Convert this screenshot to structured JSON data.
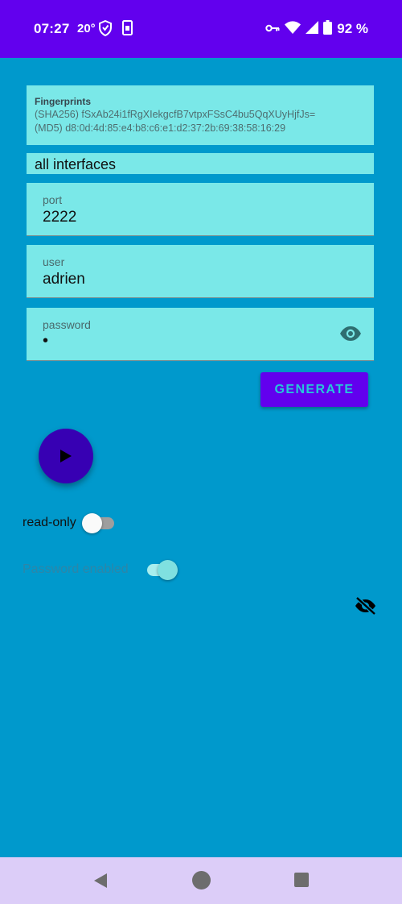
{
  "status_bar": {
    "time": "07:27",
    "temperature": "20°",
    "battery": "92 %",
    "icons": [
      "shield-icon",
      "sim-icon",
      "vpn-key-icon",
      "wifi-icon",
      "signal-icon",
      "battery-icon"
    ]
  },
  "fingerprints": {
    "title": "Fingerprints",
    "sha256": "(SHA256) fSxAb24i1fRgXIekgcfB7vtpxFSsC4bu5QqXUyHjfJs=",
    "md5": "(MD5) d8:0d:4d:85:e4:b8:c6:e1:d2:37:2b:69:38:58:16:29"
  },
  "interface": {
    "value": "all interfaces"
  },
  "port": {
    "label": "port",
    "value": "2222"
  },
  "user": {
    "label": "user",
    "value": "adrien"
  },
  "password": {
    "label": "password",
    "value": "•"
  },
  "generate_button": {
    "label": "GENERATE"
  },
  "read_only": {
    "label": "read-only",
    "checked": false
  },
  "password_enabled": {
    "label": "Password enabled",
    "checked": true
  },
  "colors": {
    "background": "#0099CC",
    "status_bar": "#6200EE",
    "field": "#7AE8E8",
    "button": "#6200EE",
    "button_text": "#26C6DA",
    "fab": "#3700B3",
    "nav_bar": "#DCCDF8"
  }
}
